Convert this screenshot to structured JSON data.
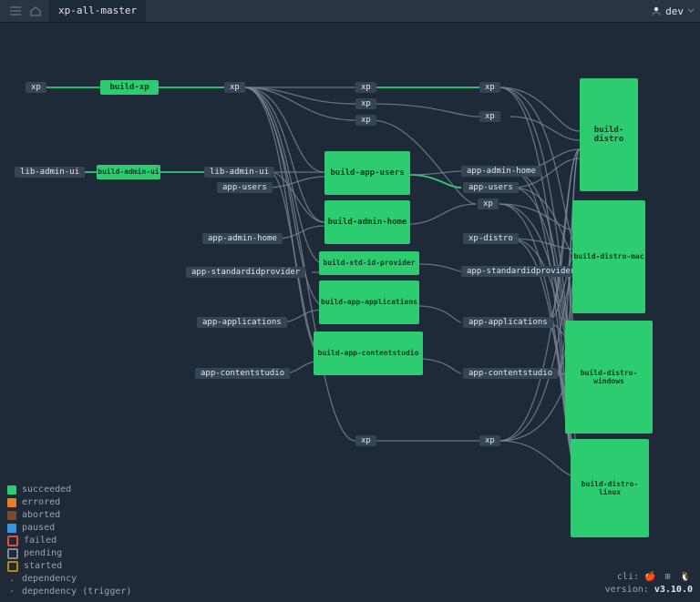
{
  "header": {
    "pipeline_name": "xp-all-master",
    "user_label": "dev"
  },
  "nodes": {
    "build_xp": "build-xp",
    "build_admin_ui": "build-admin-ui",
    "build_app_users": "build-app-users",
    "build_admin_home": "build-admin-home",
    "build_std_id_provider": "build-std-id-provider",
    "build_app_applications": "build-app-applications",
    "build_app_contentstudio": "build-app-contentstudio",
    "build_distro": "build-distro",
    "build_distro_mac": "build-distro-mac",
    "build_distro_windows": "build-distro-windows",
    "build_distro_linux": "build-distro-linux"
  },
  "resources": {
    "xp": "xp",
    "lib_admin_ui": "lib-admin-ui",
    "app_users": "app-users",
    "app_admin_home": "app-admin-home",
    "app_standardidprovider": "app-standardidprovider",
    "app_applications": "app-applications",
    "app_contentstudio": "app-contentstudio",
    "xp_distro": "xp-distro"
  },
  "legend": {
    "succeeded": "succeeded",
    "errored": "errored",
    "aborted": "aborted",
    "paused": "paused",
    "failed": "failed",
    "pending": "pending",
    "started": "started",
    "dependency": "dependency",
    "dependency_trigger": "dependency (trigger)"
  },
  "footer": {
    "cli_label": "cli:",
    "version_label": "version:",
    "version_value": "v3.10.0"
  }
}
